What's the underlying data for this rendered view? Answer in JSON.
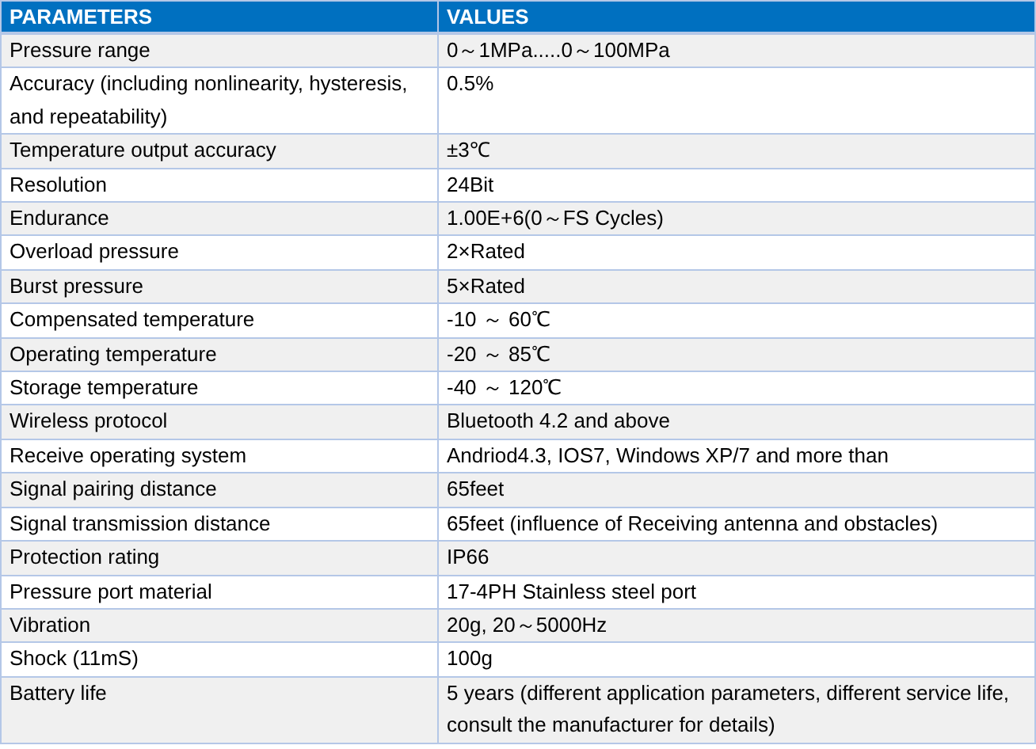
{
  "table": {
    "columns": [
      "PARAMETERS",
      "VALUES"
    ],
    "rows": [
      {
        "parameter": "Pressure range",
        "value": "0～1MPa.....0～100MPa"
      },
      {
        "parameter": "Accuracy (including nonlinearity, hysteresis, and repeatability)",
        "value": "0.5%"
      },
      {
        "parameter": "Temperature output accuracy",
        "value": "±3℃"
      },
      {
        "parameter": "Resolution",
        "value": "24Bit"
      },
      {
        "parameter": "Endurance",
        "value": "1.00E+6(0～FS Cycles)"
      },
      {
        "parameter": "Overload pressure",
        "value": "2×Rated"
      },
      {
        "parameter": "Burst pressure",
        "value": "5×Rated"
      },
      {
        "parameter": "Compensated temperature",
        "value": "-10 ～ 60℃"
      },
      {
        "parameter": "Operating temperature",
        "value": "-20 ～ 85℃"
      },
      {
        "parameter": "Storage temperature",
        "value": "-40 ～ 120℃"
      },
      {
        "parameter": "Wireless protocol",
        "value": "Bluetooth 4.2 and above"
      },
      {
        "parameter": "Receive operating system",
        "value": "Andriod4.3, IOS7, Windows XP/7 and more than"
      },
      {
        "parameter": "Signal pairing distance",
        "value": "65feet"
      },
      {
        "parameter": "Signal transmission distance",
        "value": "65feet (influence of Receiving antenna and obstacles)"
      },
      {
        "parameter": "Protection rating",
        "value": "IP66"
      },
      {
        "parameter": "Pressure port material",
        "value": "17-4PH Stainless steel port"
      },
      {
        "parameter": "Vibration",
        "value": "20g, 20～5000Hz"
      },
      {
        "parameter": "Shock (11mS)",
        "value": "100g"
      },
      {
        "parameter": "Battery life",
        "value": "5 years (different application parameters, different service life, consult the manufacturer for details)"
      }
    ]
  }
}
